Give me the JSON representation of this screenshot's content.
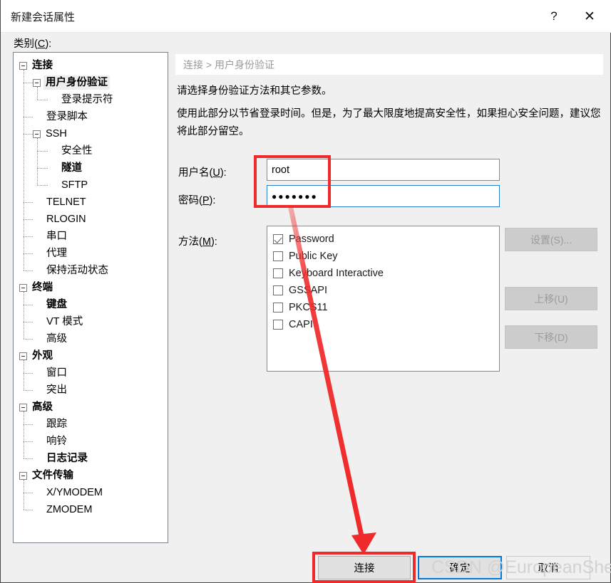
{
  "window": {
    "title": "新建会话属性",
    "help_icon": "question-mark-icon",
    "close_icon": "close-icon"
  },
  "category": {
    "label_prefix": "类别(",
    "label_key": "C",
    "label_suffix": "):"
  },
  "tree": {
    "items": [
      {
        "label": "连接",
        "level": 0,
        "expander": true,
        "bold": true,
        "selected": false
      },
      {
        "label": "用户身份验证",
        "level": 1,
        "expander": true,
        "bold": true,
        "selected": true
      },
      {
        "label": "登录提示符",
        "level": 2,
        "expander": false,
        "bold": false,
        "selected": false
      },
      {
        "label": "登录脚本",
        "level": 1,
        "expander": false,
        "bold": false,
        "selected": false
      },
      {
        "label": "SSH",
        "level": 1,
        "expander": true,
        "bold": false,
        "selected": false
      },
      {
        "label": "安全性",
        "level": 2,
        "expander": false,
        "bold": false,
        "selected": false
      },
      {
        "label": "隧道",
        "level": 2,
        "expander": false,
        "bold": true,
        "selected": false
      },
      {
        "label": "SFTP",
        "level": 2,
        "expander": false,
        "bold": false,
        "selected": false
      },
      {
        "label": "TELNET",
        "level": 1,
        "expander": false,
        "bold": false,
        "selected": false
      },
      {
        "label": "RLOGIN",
        "level": 1,
        "expander": false,
        "bold": false,
        "selected": false
      },
      {
        "label": "串口",
        "level": 1,
        "expander": false,
        "bold": false,
        "selected": false
      },
      {
        "label": "代理",
        "level": 1,
        "expander": false,
        "bold": false,
        "selected": false
      },
      {
        "label": "保持活动状态",
        "level": 1,
        "expander": false,
        "bold": false,
        "selected": false
      },
      {
        "label": "终端",
        "level": 0,
        "expander": true,
        "bold": true,
        "selected": false
      },
      {
        "label": "键盘",
        "level": 1,
        "expander": false,
        "bold": true,
        "selected": false
      },
      {
        "label": "VT 模式",
        "level": 1,
        "expander": false,
        "bold": false,
        "selected": false
      },
      {
        "label": "高级",
        "level": 1,
        "expander": false,
        "bold": false,
        "selected": false
      },
      {
        "label": "外观",
        "level": 0,
        "expander": true,
        "bold": true,
        "selected": false
      },
      {
        "label": "窗口",
        "level": 1,
        "expander": false,
        "bold": false,
        "selected": false
      },
      {
        "label": "突出",
        "level": 1,
        "expander": false,
        "bold": false,
        "selected": false
      },
      {
        "label": "高级",
        "level": 0,
        "expander": true,
        "bold": true,
        "selected": false
      },
      {
        "label": "跟踪",
        "level": 1,
        "expander": false,
        "bold": false,
        "selected": false
      },
      {
        "label": "响铃",
        "level": 1,
        "expander": false,
        "bold": false,
        "selected": false
      },
      {
        "label": "日志记录",
        "level": 1,
        "expander": false,
        "bold": true,
        "selected": false
      },
      {
        "label": "文件传输",
        "level": 0,
        "expander": true,
        "bold": true,
        "selected": false
      },
      {
        "label": "X/YMODEM",
        "level": 1,
        "expander": false,
        "bold": false,
        "selected": false
      },
      {
        "label": "ZMODEM",
        "level": 1,
        "expander": false,
        "bold": false,
        "selected": false
      }
    ]
  },
  "content": {
    "breadcrumb": "连接 > 用户身份验证",
    "description_line1": "请选择身份验证方法和其它参数。",
    "description_line2": "使用此部分以节省登录时间。但是，为了最大限度地提高安全性，如果担心安全问题，建议您将此部分留空。",
    "username_label": "用户名(U):",
    "username_value": "root",
    "password_label": "密码(P):",
    "password_value": "●●●●●●●",
    "method_label": "方法(M):",
    "methods": [
      {
        "label": "Password",
        "checked": true
      },
      {
        "label": "Public Key",
        "checked": false
      },
      {
        "label": "Keyboard Interactive",
        "checked": false
      },
      {
        "label": "GSSAPI",
        "checked": false
      },
      {
        "label": "PKCS11",
        "checked": false
      },
      {
        "label": "CAPI",
        "checked": false
      }
    ]
  },
  "side_buttons": {
    "settings": "设置(S)...",
    "move_up": "上移(U)",
    "move_down": "下移(D)"
  },
  "footer": {
    "connect": "连接",
    "ok": "确定",
    "cancel": "取消"
  },
  "annotations": {
    "arrow_color": "#f02a2a",
    "box_color": "#f02a2a"
  },
  "watermark": {
    "text": "CSDN @EuropeanSheik",
    "color": "#d2d2d2"
  }
}
